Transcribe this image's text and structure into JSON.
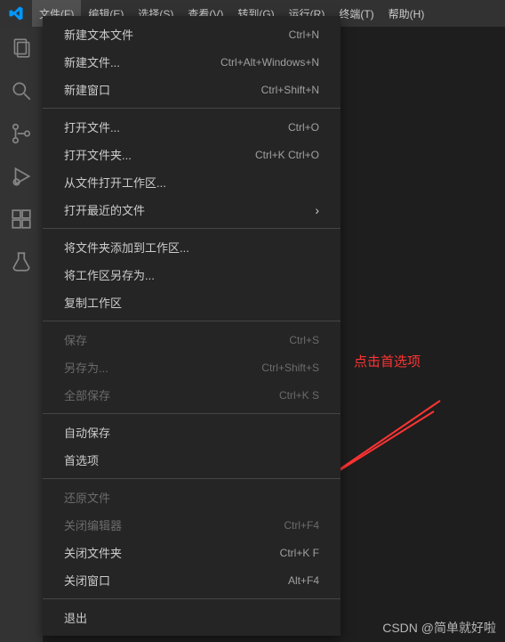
{
  "menubar": {
    "items": [
      {
        "label": "文件(F)"
      },
      {
        "label": "编辑(E)"
      },
      {
        "label": "选择(S)"
      },
      {
        "label": "查看(V)"
      },
      {
        "label": "转到(G)"
      },
      {
        "label": "运行(R)"
      },
      {
        "label": "终端(T)"
      },
      {
        "label": "帮助(H)"
      }
    ]
  },
  "dropdown": {
    "groups": [
      [
        {
          "label": "新建文本文件",
          "shortcut": "Ctrl+N"
        },
        {
          "label": "新建文件...",
          "shortcut": "Ctrl+Alt+Windows+N"
        },
        {
          "label": "新建窗口",
          "shortcut": "Ctrl+Shift+N"
        }
      ],
      [
        {
          "label": "打开文件...",
          "shortcut": "Ctrl+O"
        },
        {
          "label": "打开文件夹...",
          "shortcut": "Ctrl+K Ctrl+O"
        },
        {
          "label": "从文件打开工作区..."
        },
        {
          "label": "打开最近的文件",
          "submenu": true
        }
      ],
      [
        {
          "label": "将文件夹添加到工作区..."
        },
        {
          "label": "将工作区另存为..."
        },
        {
          "label": "复制工作区"
        }
      ],
      [
        {
          "label": "保存",
          "shortcut": "Ctrl+S",
          "disabled": true
        },
        {
          "label": "另存为...",
          "shortcut": "Ctrl+Shift+S",
          "disabled": true
        },
        {
          "label": "全部保存",
          "shortcut": "Ctrl+K S",
          "disabled": true
        }
      ],
      [
        {
          "label": "自动保存"
        },
        {
          "label": "首选项"
        }
      ],
      [
        {
          "label": "还原文件",
          "disabled": true
        },
        {
          "label": "关闭编辑器",
          "shortcut": "Ctrl+F4",
          "disabled": true
        },
        {
          "label": "关闭文件夹",
          "shortcut": "Ctrl+K F"
        },
        {
          "label": "关闭窗口",
          "shortcut": "Alt+F4"
        }
      ],
      [
        {
          "label": "退出"
        }
      ]
    ]
  },
  "annotation": {
    "text": "点击首选项"
  },
  "watermark": {
    "text": "CSDN @简单就好啦"
  }
}
